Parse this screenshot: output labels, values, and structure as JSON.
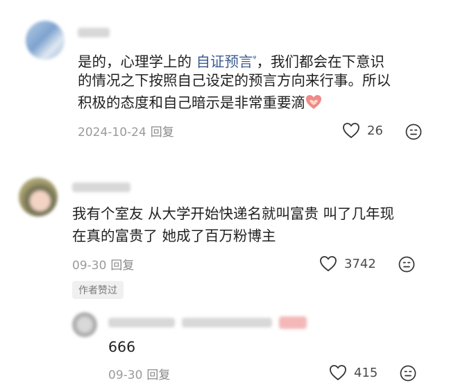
{
  "comments": [
    {
      "text_before_link": "是的，心理学上的 ",
      "link_text": "自证预言",
      "link_suffix": "ᵠ",
      "text_line1_rest": "，我们都会在下意识",
      "line2": "的情况之下按照自己设定的预言方向来行事。所以",
      "line3": "积极的态度和自己暗示是非常重要滴",
      "date": "2024-10-24",
      "reply_label": "回复",
      "likes": "26"
    },
    {
      "line1": "我有个室友 从大学开始快递名就叫富贵 叫了几年现",
      "line2": "在真的富贵了 她成了百万粉博主",
      "date": "09-30",
      "reply_label": "回复",
      "likes": "3742",
      "author_badge": "作者赞过"
    },
    {
      "text": "666",
      "date": "09-30",
      "reply_label": "回复",
      "likes": "415"
    }
  ],
  "icons": {
    "like": "heart-outline-icon",
    "dislike": "neutral-face-icon",
    "link_search": "search-icon",
    "emoji": "heart-hands-emoji"
  },
  "colors": {
    "link": "#3b5c8f",
    "meta": "#9a9a9a",
    "text": "#1f1f1f"
  }
}
